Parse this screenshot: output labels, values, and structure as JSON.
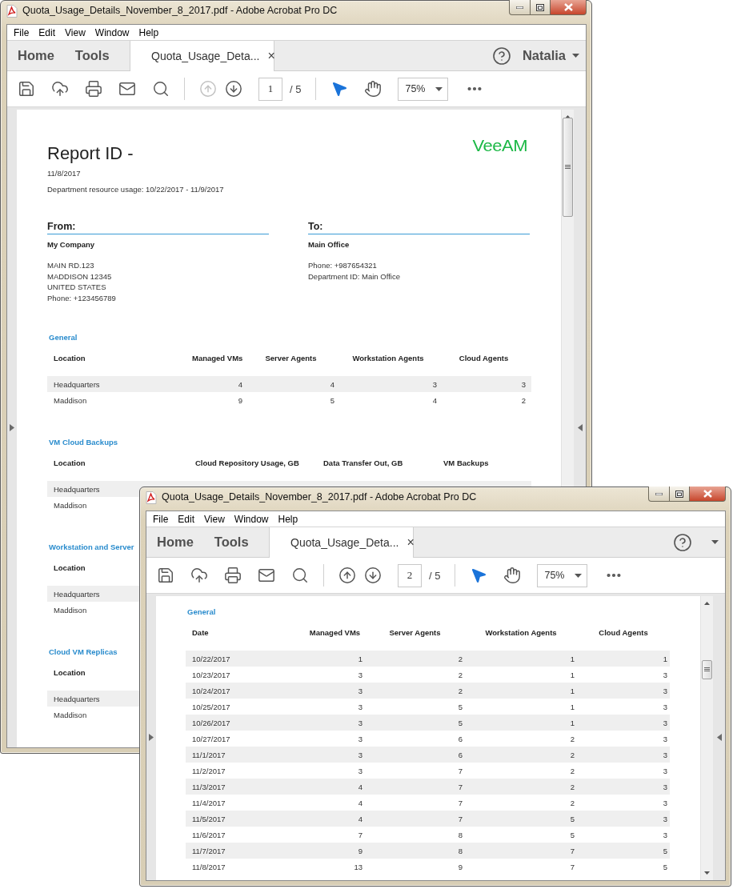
{
  "windows": [
    {
      "title": "Quota_Usage_Details_November_8_2017.pdf - Adobe Acrobat Pro DC",
      "menu": [
        "File",
        "Edit",
        "View",
        "Window",
        "Help"
      ],
      "nav": [
        "Home",
        "Tools"
      ],
      "document_tab": {
        "label": "Quota_Usage_Deta...",
        "close": "×"
      },
      "user": "Natalia",
      "toolbar": {
        "prev_disabled": true,
        "page": "1",
        "page_of": "/ 5",
        "select_tool_active": true,
        "zoom": "75%"
      },
      "page": {
        "logo": "VeeAM",
        "title": "Report ID -",
        "date": "11/8/2017",
        "usage": "Department resource usage: 10/22/2017 - 11/9/2017",
        "from": {
          "heading": "From:",
          "name": "My Company",
          "lines": [
            "MAIN RD.123",
            "MADDISON 12345",
            "UNITED STATES",
            "Phone: +123456789"
          ]
        },
        "to": {
          "heading": "To:",
          "name": "Main Office",
          "lines": [
            "Phone: +987654321",
            "Department ID: Main Office"
          ]
        },
        "sections": [
          {
            "title": "General",
            "columns": [
              "Location",
              "Managed VMs",
              "Server Agents",
              "Workstation Agents",
              "Cloud Agents"
            ],
            "rows": [
              [
                "Headquarters",
                "4",
                "4",
                "3",
                "3"
              ],
              [
                "Maddison",
                "9",
                "5",
                "4",
                "2"
              ]
            ]
          },
          {
            "title": "VM Cloud Backups",
            "columns": [
              "Location",
              "Cloud Repository Usage, GB",
              "Data Transfer Out, GB",
              "VM Backups"
            ],
            "rows": [
              [
                "Headquarters"
              ],
              [
                "Maddison"
              ]
            ]
          },
          {
            "title": "Workstation and Server",
            "columns": [
              "Location"
            ],
            "rows": [
              [
                "Headquarters"
              ],
              [
                "Maddison"
              ]
            ]
          },
          {
            "title": "Cloud VM Replicas",
            "columns": [
              "Location"
            ],
            "rows": [
              [
                "Headquarters"
              ],
              [
                "Maddison"
              ]
            ]
          }
        ]
      }
    },
    {
      "title": "Quota_Usage_Details_November_8_2017.pdf - Adobe Acrobat Pro DC",
      "menu": [
        "File",
        "Edit",
        "View",
        "Window",
        "Help"
      ],
      "nav": [
        "Home",
        "Tools"
      ],
      "document_tab": {
        "label": "Quota_Usage_Deta...",
        "close": "×"
      },
      "toolbar": {
        "prev_disabled": false,
        "page": "2",
        "page_of": "/ 5",
        "select_tool_active": true,
        "zoom": "75%"
      },
      "page": {
        "sections": [
          {
            "title": "General",
            "columns": [
              "Date",
              "Managed VMs",
              "Server Agents",
              "Workstation Agents",
              "Cloud Agents"
            ],
            "rows": [
              [
                "10/22/2017",
                "1",
                "2",
                "1",
                "1"
              ],
              [
                "10/23/2017",
                "3",
                "2",
                "1",
                "3"
              ],
              [
                "10/24/2017",
                "3",
                "2",
                "1",
                "3"
              ],
              [
                "10/25/2017",
                "3",
                "5",
                "1",
                "3"
              ],
              [
                "10/26/2017",
                "3",
                "5",
                "1",
                "3"
              ],
              [
                "10/27/2017",
                "3",
                "6",
                "2",
                "3"
              ],
              [
                "11/1/2017",
                "3",
                "6",
                "2",
                "3"
              ],
              [
                "11/2/2017",
                "3",
                "7",
                "2",
                "3"
              ],
              [
                "11/3/2017",
                "4",
                "7",
                "2",
                "3"
              ],
              [
                "11/4/2017",
                "4",
                "7",
                "2",
                "3"
              ],
              [
                "11/5/2017",
                "4",
                "7",
                "5",
                "3"
              ],
              [
                "11/6/2017",
                "7",
                "8",
                "5",
                "3"
              ],
              [
                "11/7/2017",
                "9",
                "8",
                "7",
                "5"
              ],
              [
                "11/8/2017",
                "13",
                "9",
                "7",
                "5"
              ]
            ]
          }
        ]
      }
    }
  ]
}
